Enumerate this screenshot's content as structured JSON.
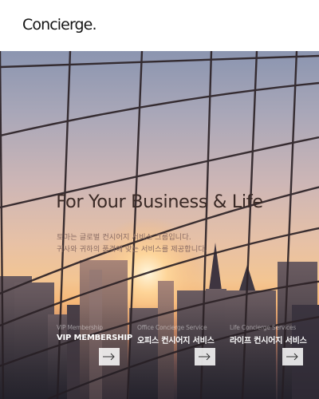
{
  "header": {
    "logo": "Concierge."
  },
  "hero": {
    "title": "For Your Business & Life",
    "description": [
      "토마는 글로벌 컨시어지 서비스 그룹입니다.",
      "귀사와 귀하의 품격에 맞는 서비스를 제공합니다."
    ]
  },
  "services": [
    {
      "subtitle": "VIP Membership",
      "title": "VIP MEMBERSHIP",
      "arrow_icon": "arrow-right-icon"
    },
    {
      "subtitle": "Office Concierge Service",
      "title": "오피스 컨시어지 서비스",
      "arrow_icon": "arrow-right-icon"
    },
    {
      "subtitle": "Life Concierge Services",
      "title": "라이프 컨시어지 서비스",
      "arrow_icon": "arrow-right-icon"
    }
  ],
  "colors": {
    "logo": "#151515",
    "title": "#3a2a26",
    "description": "#8a6c64",
    "service_text": "#ffffff"
  }
}
